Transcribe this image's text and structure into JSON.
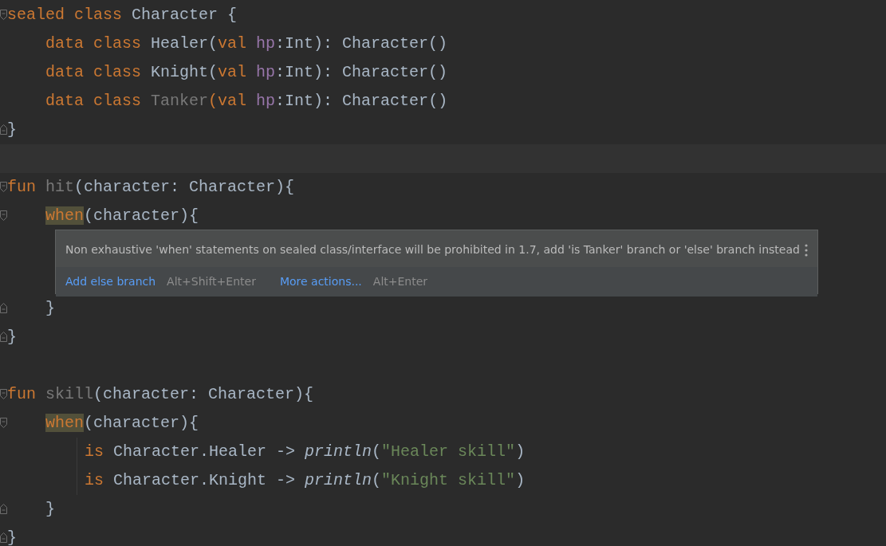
{
  "editor": {
    "lines": [
      {
        "kind": "fold-start",
        "tokens": [
          {
            "kind": "keyword",
            "text": "sealed class"
          },
          {
            "kind": "plain",
            "text": " Character {"
          }
        ],
        "children": [
          {
            "kind": "code",
            "tokens": [
              {
                "kind": "keyword",
                "text": "data class"
              },
              {
                "kind": "plain",
                "text": " Healer("
              },
              {
                "kind": "keyword",
                "text": "val"
              },
              {
                "kind": "param",
                "text": " hp"
              },
              {
                "kind": "plain",
                "text": ":Int): Character()"
              }
            ]
          },
          {
            "kind": "code",
            "tokens": [
              {
                "kind": "keyword",
                "text": "data class"
              },
              {
                "kind": "plain",
                "text": " Knight("
              },
              {
                "kind": "keyword",
                "text": "val"
              },
              {
                "kind": "param",
                "text": " hp"
              },
              {
                "kind": "plain",
                "text": ":Int): Character()"
              }
            ]
          },
          {
            "kind": "code",
            "tokens": [
              {
                "kind": "keyword",
                "text": "data class"
              },
              {
                "kind": "unused",
                "text": " Tanker"
              },
              {
                "kind": "keyword",
                "text": "("
              },
              {
                "kind": "keyword",
                "text": "val"
              },
              {
                "kind": "param",
                "text": " hp"
              },
              {
                "kind": "plain",
                "text": ":Int): Character()"
              }
            ]
          }
        ]
      },
      {
        "kind": "fold-end",
        "tokens": [
          {
            "kind": "plain",
            "text": "}"
          }
        ]
      },
      {
        "kind": "current"
      },
      {
        "kind": "fold-start",
        "tokens": [
          {
            "kind": "keyword",
            "text": "fun"
          },
          {
            "kind": "unused",
            "text": " hit"
          },
          {
            "kind": "plain",
            "text": "(character: Character){"
          }
        ],
        "children": [
          {
            "kind": "fold-start",
            "tokens": [
              {
                "kind": "keyword",
                "text": "when",
                "highlighted": true
              },
              {
                "kind": "plain",
                "text": "(character){"
              }
            ],
            "children": [
              {
                "kind": "popup",
                "message": "Non exhaustive 'when' statements on sealed class/interface will be prohibited in 1.7, add 'is Tanker' branch or 'else' branch instead",
                "actions": [
                  {
                    "label": "Add else branch",
                    "shortcut": "Alt+Shift+Enter"
                  },
                  {
                    "label": "More actions...",
                    "shortcut": "Alt+Enter"
                  }
                ]
              }
            ]
          },
          {
            "kind": "fold-end",
            "tokens": [
              {
                "kind": "plain",
                "text": "}"
              }
            ]
          }
        ]
      },
      {
        "kind": "fold-end",
        "tokens": [
          {
            "kind": "plain",
            "text": "}"
          }
        ]
      },
      {
        "kind": "blank"
      },
      {
        "kind": "fold-start",
        "tokens": [
          {
            "kind": "keyword",
            "text": "fun"
          },
          {
            "kind": "unused",
            "text": " skill"
          },
          {
            "kind": "plain",
            "text": "(character: Character){"
          }
        ],
        "children": [
          {
            "kind": "fold-start",
            "tokens": [
              {
                "kind": "keyword",
                "text": "when",
                "highlighted": true
              },
              {
                "kind": "plain",
                "text": "(character){"
              }
            ],
            "children": [
              {
                "kind": "code",
                "tokens": [
                  {
                    "kind": "keyword",
                    "text": "is"
                  },
                  {
                    "kind": "plain",
                    "text": " Character.Healer -> "
                  },
                  {
                    "kind": "function",
                    "text": "println"
                  },
                  {
                    "kind": "plain",
                    "text": "("
                  },
                  {
                    "kind": "string",
                    "text": "\"Healer skill\""
                  },
                  {
                    "kind": "plain",
                    "text": ")"
                  }
                ]
              },
              {
                "kind": "code",
                "tokens": [
                  {
                    "kind": "keyword",
                    "text": "is"
                  },
                  {
                    "kind": "plain",
                    "text": " Character.Knight -> "
                  },
                  {
                    "kind": "function",
                    "text": "println"
                  },
                  {
                    "kind": "plain",
                    "text": "("
                  },
                  {
                    "kind": "string",
                    "text": "\"Knight skill\""
                  },
                  {
                    "kind": "plain",
                    "text": ")"
                  }
                ]
              }
            ]
          },
          {
            "kind": "fold-end",
            "tokens": [
              {
                "kind": "plain",
                "text": "}"
              }
            ]
          }
        ]
      },
      {
        "kind": "fold-end",
        "tokens": [
          {
            "kind": "plain",
            "text": "}"
          }
        ]
      }
    ]
  }
}
